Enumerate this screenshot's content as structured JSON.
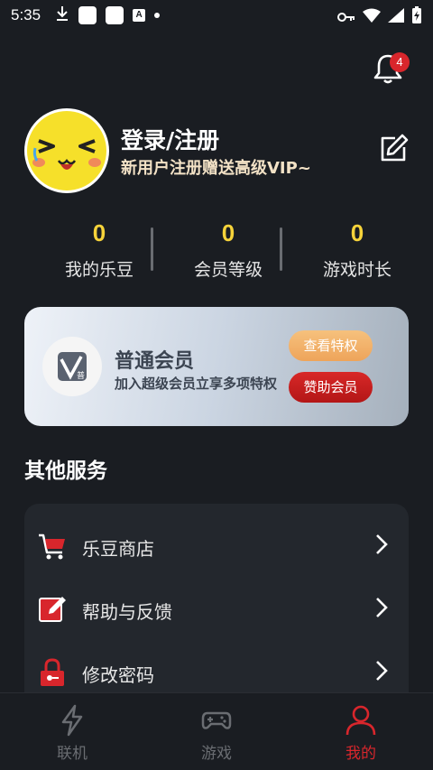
{
  "status_bar": {
    "time": "5:35",
    "icons": [
      "download-icon",
      "app-square-icon",
      "app-square-icon",
      "font-a-icon",
      "dot-icon",
      "vpn-key-icon",
      "wifi-icon",
      "signal-icon",
      "battery-charging-icon"
    ],
    "font_icon_text": "A"
  },
  "notifications": {
    "badge_count": "4",
    "icon": "bell-icon"
  },
  "profile": {
    "title": "登录/注册",
    "subtitle": "新用户注册赠送高级VIP~",
    "edit_icon": "edit-icon"
  },
  "stats": [
    {
      "value": "0",
      "label": "我的乐豆"
    },
    {
      "value": "0",
      "label": "会员等级"
    },
    {
      "value": "0",
      "label": "游戏时长"
    }
  ],
  "vip_card": {
    "title": "普通会员",
    "subtitle": "加入超级会员立享多项特权",
    "logo_badge": "普",
    "view_button": "查看特权",
    "sponsor_button": "赞助会员"
  },
  "services": {
    "title": "其他服务",
    "items": [
      {
        "label": "乐豆商店",
        "icon": "cart-icon"
      },
      {
        "label": "帮助与反馈",
        "icon": "feedback-icon"
      },
      {
        "label": "修改密码",
        "icon": "lock-icon"
      }
    ]
  },
  "bottom_nav": {
    "items": [
      {
        "label": "联机",
        "icon": "lightning-icon",
        "active": false
      },
      {
        "label": "游戏",
        "icon": "gamepad-icon",
        "active": false
      },
      {
        "label": "我的",
        "icon": "person-icon",
        "active": true
      }
    ]
  },
  "colors": {
    "background": "#1a1d22",
    "accent_red": "#d8262c",
    "stat_yellow": "#f6d33a",
    "subtitle_cream": "#f3e2c6"
  }
}
